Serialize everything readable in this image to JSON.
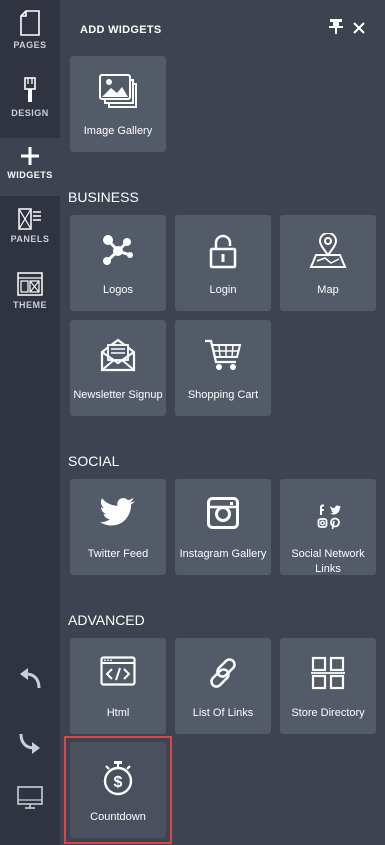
{
  "rail": {
    "pages_label": "PAGES",
    "design_label": "DESIGN",
    "widgets_label": "WIDGETS",
    "panels_label": "PANELS",
    "theme_label": "THEME"
  },
  "panel": {
    "title": "ADD WIDGETS",
    "image_gallery": "Image Gallery",
    "sections": {
      "business": "BUSINESS",
      "social": "SOCIAL",
      "advanced": "ADVANCED"
    },
    "business": [
      "Logos",
      "Login",
      "Map",
      "Newsletter Signup",
      "Shopping Cart"
    ],
    "social": [
      "Twitter Feed",
      "Instagram Gallery",
      "Social Network Links"
    ],
    "advanced": [
      "Html",
      "List Of Links",
      "Store Directory",
      "Countdown"
    ]
  },
  "colors": {
    "rail_bg": "#2f3440",
    "panel_bg": "#3d4350",
    "tile_bg": "#535a68",
    "highlight": "#e04545"
  }
}
